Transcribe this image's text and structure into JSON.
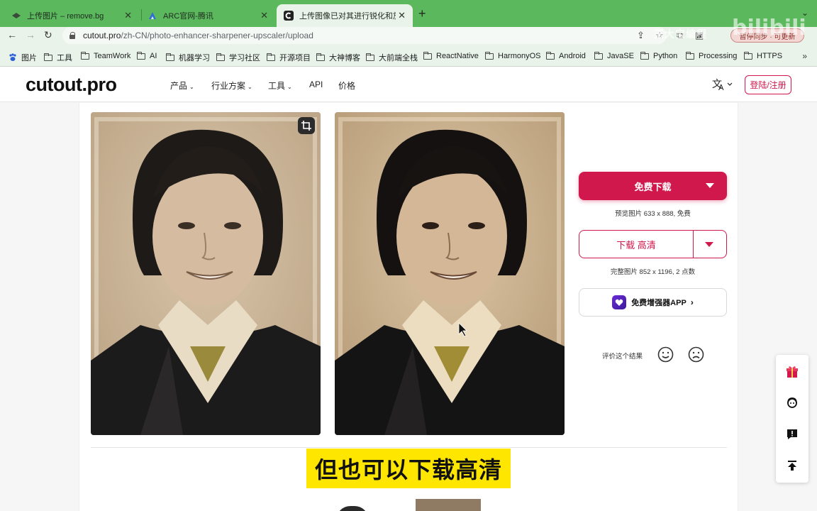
{
  "browser": {
    "tabs": [
      {
        "title": "上传图片 – remove.bg"
      },
      {
        "title": "ARC官网-腾讯"
      },
      {
        "title": "上传图像已对其进行锐化和放大",
        "active": true
      }
    ],
    "url_host": "cutout.pro",
    "url_path": "/zh-CN/photo-enhancer-sharpener-upscaler/upload",
    "bookmarks": [
      "图片",
      "工具",
      "TeamWork",
      "AI",
      "机器学习",
      "学习社区",
      "开源项目",
      "大神博客",
      "大前端全栈",
      "ReactNative",
      "HarmonyOS",
      "Android",
      "JavaSE",
      "Python",
      "Processing",
      "HTTPS"
    ],
    "more": "»",
    "profile_label": "暂停同步 · 可更新"
  },
  "watermark": {
    "text": "王大宝编程",
    "logo": "bilibili"
  },
  "site": {
    "logo": "cutout.pro",
    "nav": [
      "产品",
      "行业方案",
      "工具",
      "API",
      "价格"
    ],
    "login": "登陆/注册"
  },
  "download": {
    "free_label": "免费下载",
    "free_note": "预览图片 633 x 888, 免费",
    "hd_label": "下载 高清",
    "hd_note": "完整图片 852 x 1196, 2 点数",
    "app_label": "免费增强器APP",
    "rate_label": "评价这个结果"
  },
  "caption": "但也可以下载高清",
  "colors": {
    "accent": "#d1184d",
    "tabstrip": "#5bb85d",
    "caption_bg": "#ffe600"
  }
}
